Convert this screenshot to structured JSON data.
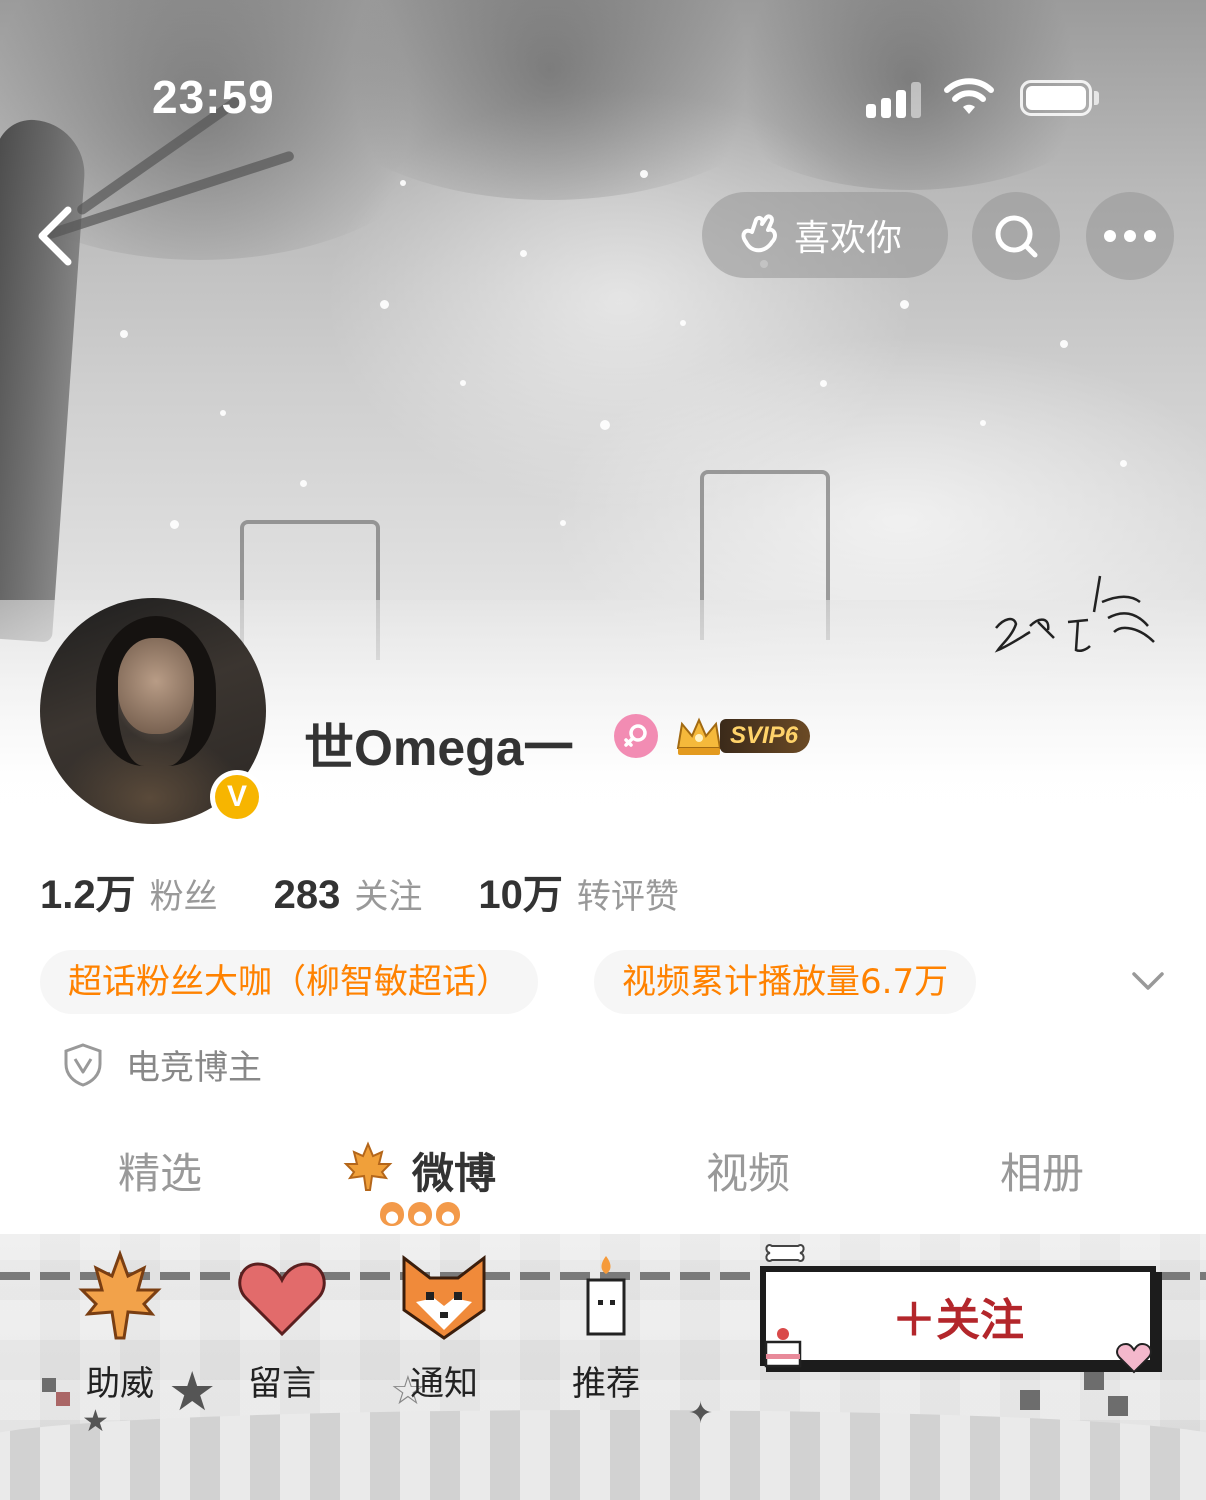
{
  "status_bar": {
    "time": "23:59"
  },
  "top_nav": {
    "like_label": "喜欢你"
  },
  "profile": {
    "username": "世Omega一",
    "svip_label": "SVIP6",
    "verified_glyph": "V"
  },
  "stats": [
    {
      "value": "1.2万",
      "label": "粉丝"
    },
    {
      "value": "283",
      "label": "关注"
    },
    {
      "value": "10万",
      "label": "转评赞"
    }
  ],
  "tags": {
    "super_topic": "超话粉丝大咖（柳智敏超话）",
    "video_plays": "视频累计播放量6.7万"
  },
  "identity": {
    "label": "电竞博主"
  },
  "tabs": [
    {
      "label": "精选",
      "active": false
    },
    {
      "label": "微博",
      "active": true
    },
    {
      "label": "视频",
      "active": false
    },
    {
      "label": "相册",
      "active": false
    }
  ],
  "actions": [
    {
      "label": "助威",
      "icon": "maple-leaf-icon"
    },
    {
      "label": "留言",
      "icon": "heart-icon"
    },
    {
      "label": "通知",
      "icon": "fox-icon"
    },
    {
      "label": "推荐",
      "icon": "candle-icon"
    }
  ],
  "follow_button": {
    "label": "＋关注"
  },
  "colors": {
    "accent_orange": "#ff8200",
    "follow_red": "#b3262b",
    "verified_gold": "#f7b500",
    "gender_pink": "#f28cb3"
  }
}
